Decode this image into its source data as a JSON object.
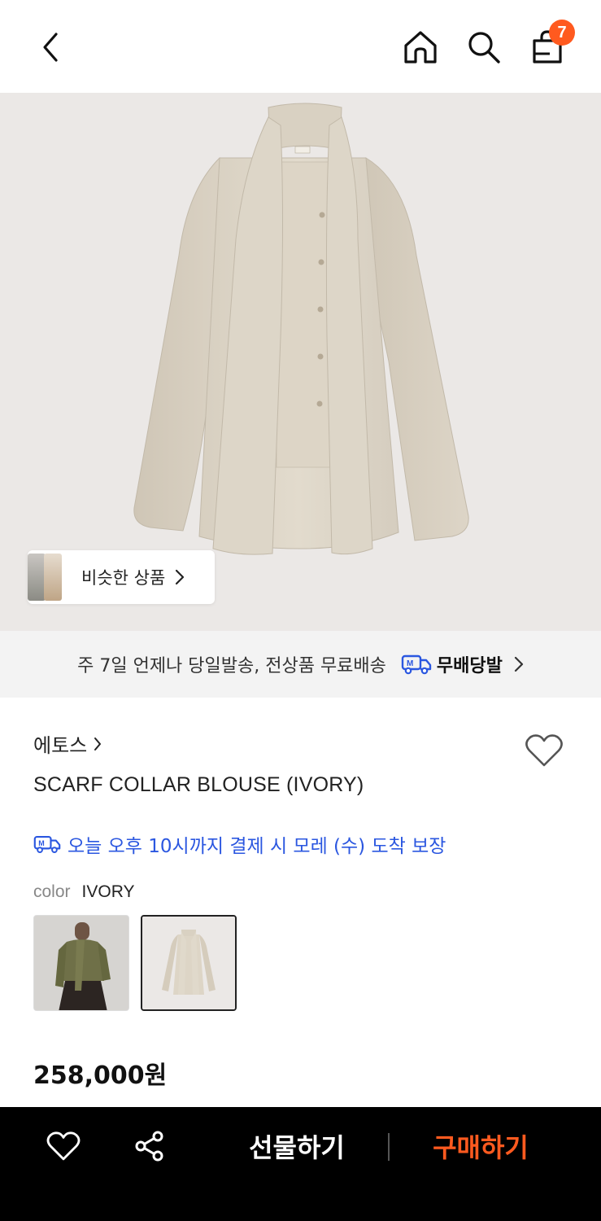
{
  "header": {
    "cart_count": "7",
    "icons": [
      "chevron-left-icon",
      "home-icon",
      "search-icon",
      "shopping-bag-icon"
    ],
    "badge_color": "#ff5a1f"
  },
  "hero": {
    "background": "#ebe8e6",
    "similar_label": "비슷한 상품"
  },
  "shipping": {
    "text": "주 7일 언제나 당일발송, 전상품 무료배송",
    "service_label": "무배당발"
  },
  "product": {
    "brand": "에토스",
    "name": "SCARF COLLAR BLOUSE (IVORY)",
    "delivery_text": "오늘 오후 10시까지 결제 시 모레 (수) 도착 보장",
    "delivery_color": "#2b57e0",
    "color_label": "color",
    "color_value": "IVORY",
    "price": "258,000원"
  },
  "bottom_bar": {
    "gift_label": "선물하기",
    "buy_label": "구매하기",
    "buy_color": "#ff5a1f"
  }
}
